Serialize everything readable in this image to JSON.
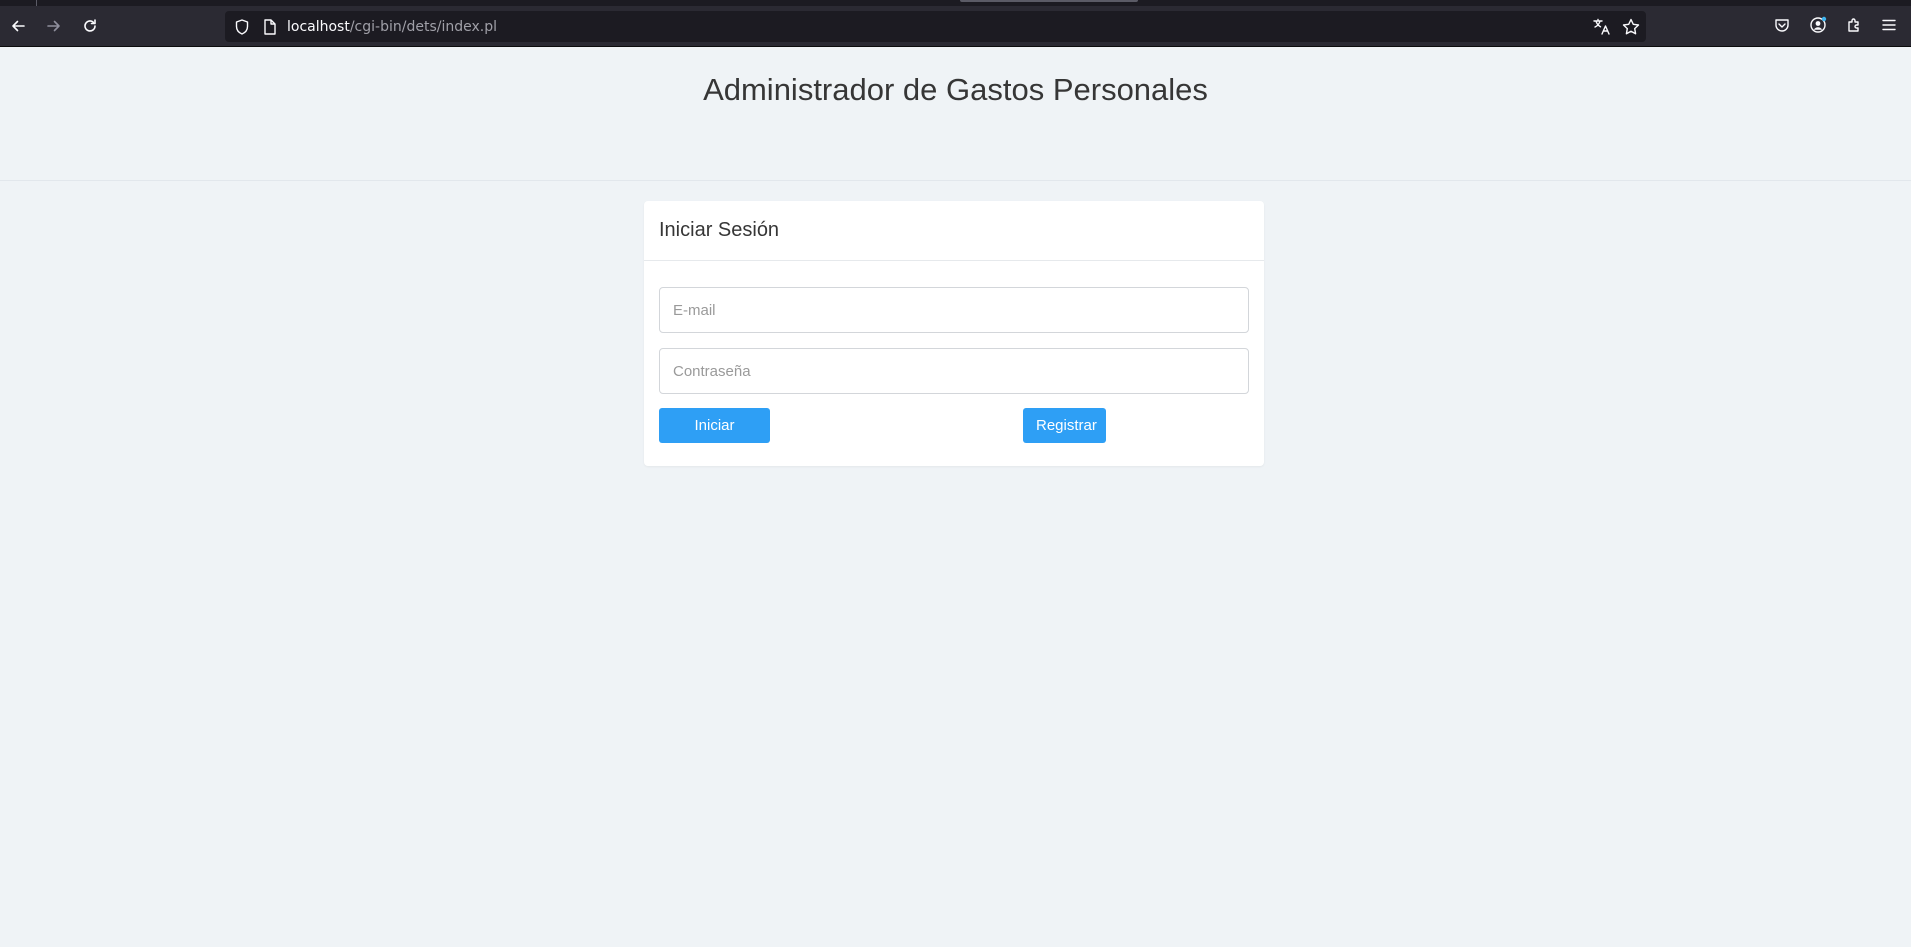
{
  "browser": {
    "url_host": "localhost",
    "url_path": "/cgi-bin/dets/index.pl"
  },
  "page": {
    "title": "Administrador de Gastos Personales"
  },
  "login_card": {
    "title": "Iniciar Sesión",
    "email_placeholder": "E-mail",
    "email_value": "",
    "password_placeholder": "Contraseña",
    "password_value": "",
    "login_label": "Iniciar Sesión",
    "register_label": "Registrar"
  },
  "colors": {
    "accent": "#2e9ff5",
    "page_background": "#eff3f6",
    "toolbar_background": "#2b2a33"
  }
}
